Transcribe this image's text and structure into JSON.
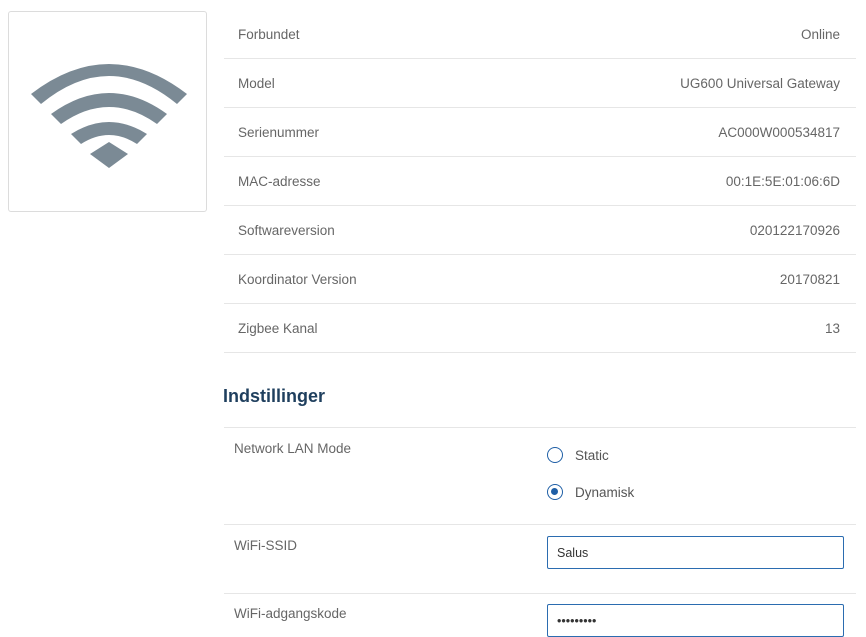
{
  "device": {
    "icon": "wifi-icon",
    "icon_color": "#7b8a95"
  },
  "info_rows": [
    {
      "label": "Forbundet",
      "value": "Online"
    },
    {
      "label": "Model",
      "value": "UG600 Universal Gateway"
    },
    {
      "label": "Serienummer",
      "value": "AC000W000534817"
    },
    {
      "label": "MAC-adresse",
      "value": "00:1E:5E:01:06:6D"
    },
    {
      "label": "Softwareversion",
      "value": "020122170926"
    },
    {
      "label": "Koordinator Version",
      "value": "20170821"
    },
    {
      "label": "Zigbee Kanal",
      "value": "13"
    }
  ],
  "settings": {
    "title": "Indstillinger",
    "lan_mode": {
      "label": "Network LAN Mode",
      "options": [
        {
          "label": "Static",
          "checked": false
        },
        {
          "label": "Dynamisk",
          "checked": true
        }
      ]
    },
    "ssid": {
      "label": "WiFi-SSID",
      "value": "Salus"
    },
    "password": {
      "label": "WiFi-adgangskode",
      "value": "•••••••••"
    }
  },
  "colors": {
    "accent": "#1f5fa6",
    "title": "#1f3f5e"
  }
}
